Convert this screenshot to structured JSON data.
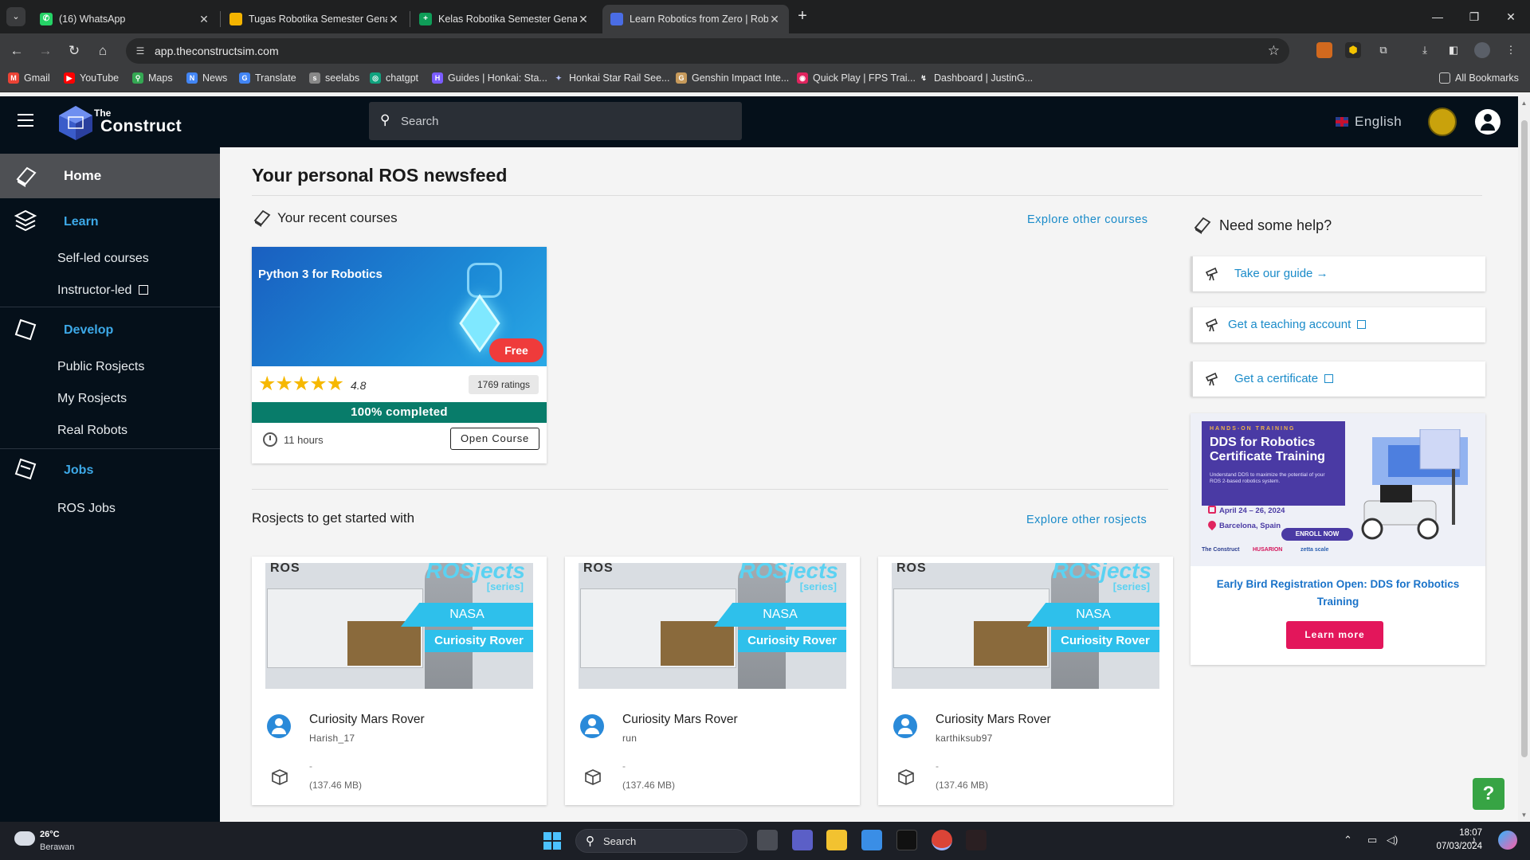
{
  "browser": {
    "tabs": [
      {
        "title": "(16) WhatsApp",
        "active": false,
        "favicon_color": "#25d366"
      },
      {
        "title": "Tugas Robotika Semester Genap",
        "active": false,
        "favicon_color": "#f4b400"
      },
      {
        "title": "Kelas Robotika Semester Genap",
        "active": false,
        "favicon_color": "#0f9d58"
      },
      {
        "title": "Learn Robotics from Zero | Rob",
        "active": true,
        "favicon_color": "#4a6de5"
      }
    ],
    "url": "app.theconstructsim.com",
    "bookmarks": [
      {
        "label": "Gmail",
        "icon": "gmail-icon",
        "color": "#ea4335"
      },
      {
        "label": "YouTube",
        "icon": "youtube-icon",
        "color": "#ff0000"
      },
      {
        "label": "Maps",
        "icon": "maps-icon",
        "color": "#34a853"
      },
      {
        "label": "News",
        "icon": "news-icon",
        "color": "#4285f4"
      },
      {
        "label": "Translate",
        "icon": "translate-icon",
        "color": "#4285f4"
      },
      {
        "label": "seelabs",
        "icon": "seelabs-icon",
        "color": "#888888"
      },
      {
        "label": "chatgpt",
        "icon": "chatgpt-icon",
        "color": "#10a37f"
      },
      {
        "label": "Guides | Honkai: Sta...",
        "icon": "honkai-icon",
        "color": "#7a5cff"
      },
      {
        "label": "Honkai Star Rail See...",
        "icon": "star-rail-icon",
        "color": "#b8c4ff"
      },
      {
        "label": "Genshin Impact Inte...",
        "icon": "genshin-icon",
        "color": "#c79a5b"
      },
      {
        "label": "Quick Play | FPS Trai...",
        "icon": "fps-icon",
        "color": "#e0245e"
      },
      {
        "label": "Dashboard | JustinG...",
        "icon": "dashboard-icon",
        "color": "#dddddd"
      }
    ],
    "all_bookmarks": "All Bookmarks"
  },
  "header": {
    "logo_small": "The",
    "logo_big": "Construct",
    "search_placeholder": "Search",
    "language": "English"
  },
  "sidebar": {
    "home": "Home",
    "learn": "Learn",
    "learn_items": [
      "Self-led courses",
      "Instructor-led"
    ],
    "develop": "Develop",
    "develop_items": [
      "Public Rosjects",
      "My Rosjects",
      "Real Robots"
    ],
    "jobs": "Jobs",
    "jobs_items": [
      "ROS Jobs"
    ]
  },
  "main": {
    "title": "Your personal ROS newsfeed",
    "recent_courses": {
      "heading": "Your recent courses",
      "explore": "Explore other courses",
      "course": {
        "title": "Python 3 for Robotics",
        "badge": "Free",
        "stars": "★★★★★",
        "rating": "4.8",
        "ratings_count": "1769 ratings",
        "progress_text": "100% completed",
        "progress_fraction": 1.0,
        "duration": "11 hours",
        "button": "Open Course"
      }
    },
    "rosjects": {
      "heading": "Rosjects to get started with",
      "explore": "Explore other rosjects",
      "thumb_ros": "ROS",
      "thumb_title": "ROSjects",
      "thumb_series": "[series]",
      "thumb_nasa": "NASA",
      "thumb_rover": "Curiosity Rover",
      "items": [
        {
          "name": "Curiosity Mars Rover",
          "owner": "Harish_17",
          "desc": "-",
          "size": "(137.46 MB)"
        },
        {
          "name": "Curiosity Mars Rover",
          "owner": "run",
          "desc": "-",
          "size": "(137.46 MB)"
        },
        {
          "name": "Curiosity Mars Rover",
          "owner": "karthiksub97",
          "desc": "-",
          "size": "(137.46 MB)"
        }
      ]
    },
    "help": {
      "heading": "Need some help?",
      "items": [
        "Take our guide →",
        "Get a teaching account",
        "Get a certificate"
      ],
      "promo": {
        "kicker": "HANDS-ON TRAINING",
        "title": "DDS for Robotics Certificate Training",
        "desc": "Understand DDS to maximize the potential of your ROS 2-based robotics system.",
        "date": "April 24 – 26, 2024",
        "location": "Barcelona, Spain",
        "enroll": "ENROLL NOW",
        "logos": [
          "The Construct",
          "HUSARION",
          "zetta scale"
        ],
        "caption": "Early Bird Registration Open: DDS for Robotics Training",
        "button": "Learn more"
      }
    },
    "fab": "?"
  },
  "taskbar": {
    "temperature": "26°C",
    "weather": "Berawan",
    "search": "Search",
    "time": "18:07",
    "date": "07/03/2024"
  }
}
